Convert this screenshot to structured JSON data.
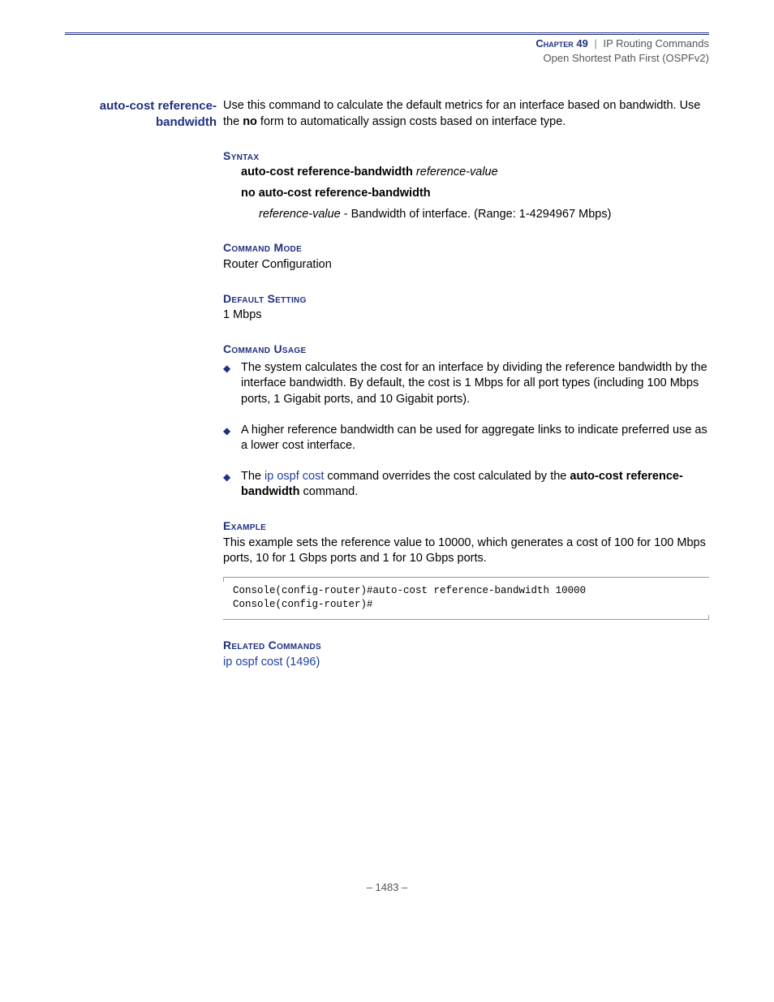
{
  "header": {
    "chapter": "Chapter 49",
    "title": "IP Routing Commands",
    "subtitle": "Open Shortest Path First (OSPFv2)"
  },
  "command": {
    "name_line1": "auto-cost reference-",
    "name_line2": "bandwidth",
    "intro_1": "Use this command to calculate the default metrics for an interface based on bandwidth. Use the ",
    "intro_no": "no",
    "intro_2": " form to automatically assign costs based on interface type."
  },
  "syntax": {
    "heading": "Syntax",
    "line1_cmd": "auto-cost reference-bandwidth",
    "line1_arg": "reference-value",
    "line2": "no auto-cost reference-bandwidth",
    "arg_name": "reference-value",
    "arg_desc": " - Bandwidth of interface. (Range: 1-4294967 Mbps)"
  },
  "command_mode": {
    "heading": "Command Mode",
    "value": "Router Configuration"
  },
  "default_setting": {
    "heading": "Default Setting",
    "value": "1 Mbps"
  },
  "command_usage": {
    "heading": "Command Usage",
    "item1": "The system calculates the cost for an interface by dividing the reference bandwidth by the interface bandwidth. By default, the cost is 1 Mbps for all port types (including 100 Mbps ports, 1 Gigabit ports, and 10 Gigabit ports).",
    "item2": "A higher reference bandwidth can be used for aggregate links to indicate preferred use as a lower cost interface.",
    "item3_a": "The ",
    "item3_link": "ip ospf cost",
    "item3_b": " command overrides the cost calculated by the ",
    "item3_bold": "auto-cost reference-bandwidth",
    "item3_c": " command."
  },
  "example": {
    "heading": "Example",
    "text": "This example sets the reference value to 10000, which generates a cost of 100 for 100 Mbps ports, 10 for 1 Gbps ports and 1 for 10 Gbps ports.",
    "code": "Console(config-router)#auto-cost reference-bandwidth 10000\nConsole(config-router)#"
  },
  "related": {
    "heading": "Related Commands",
    "link": "ip ospf cost (1496)"
  },
  "page_number": "–  1483  –"
}
